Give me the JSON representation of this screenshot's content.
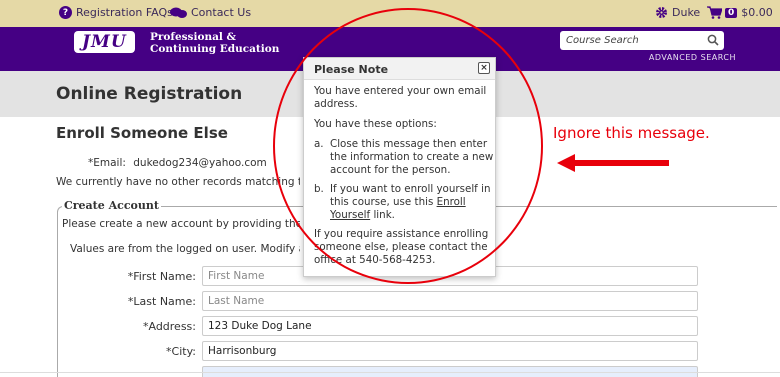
{
  "topbar": {
    "faq_label": "Registration FAQs",
    "contact_label": "Contact Us",
    "user_name": "Duke",
    "cart_count": "0",
    "cart_total": "$0.00"
  },
  "header": {
    "logo": "JMU",
    "dept_line1": "Professional &",
    "dept_line2": "Continuing Education",
    "search_placeholder": "Course Search",
    "advanced_search": "ADVANCED SEARCH"
  },
  "page": {
    "title": "Online Registration",
    "section_title": "Enroll Someone Else",
    "email_label": "*Email:",
    "email_value": "dukedog234@yahoo.com",
    "no_records": "We currently have no other records matching that e",
    "fieldset_legend": "Create Account",
    "create_desc": "Please create a new account by providing the follo",
    "values_note": "Values are from the logged on user. Modify as ne"
  },
  "form": {
    "first_name_label": "*First Name:",
    "first_name_placeholder": "First Name",
    "last_name_label": "*Last Name:",
    "last_name_placeholder": "Last Name",
    "address_label": "*Address:",
    "address_value": "123 Duke Dog Lane",
    "city_label": "*City:",
    "city_value": "Harrisonburg"
  },
  "modal": {
    "title": "Please Note",
    "close": "×",
    "p1": "You have entered your own email address.",
    "p2": "You have these options:",
    "opt_a_letter": "a.",
    "opt_a": "Close this message then enter the information to create a new account for the person.",
    "opt_b_letter": "b.",
    "opt_b_text": "If you want to enroll yourself in this course, use this ",
    "opt_b_link": "Enroll Yourself",
    "opt_b_end": " link.",
    "p3": "If you require assistance enrolling someone else, please contact the office at 540-568-4253."
  },
  "annotation": {
    "text": "Ignore this message.",
    "color": "#e8000b"
  },
  "colors": {
    "topbar": "#e5d9a6",
    "brand_purple": "#450084",
    "title_bar": "#e3e3e3"
  }
}
